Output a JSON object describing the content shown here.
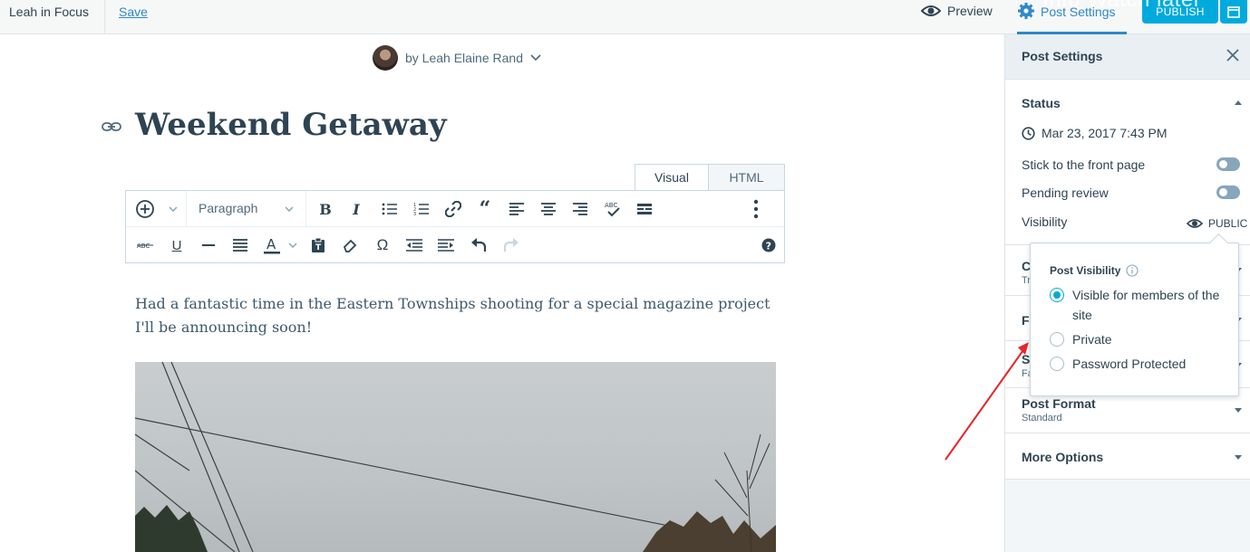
{
  "topbar": {
    "site_name": "Leah in Focus",
    "save_label": "Save",
    "preview_label": "Preview",
    "settings_label": "Post Settings",
    "publish_label": "PUBLISH",
    "overlay_text": "Info   Watch later"
  },
  "editor": {
    "author_label": "by Leah Elaine Rand",
    "title": "Weekend Getaway",
    "tabs": [
      {
        "label": "Visual",
        "active": true
      },
      {
        "label": "HTML",
        "active": false
      }
    ],
    "block_format": "Paragraph",
    "body_text": "Had a fantastic time in the Eastern Townships shooting for a special magazine project I'll be announcing soon!"
  },
  "sidebar": {
    "title": "Post Settings",
    "status": {
      "heading": "Status",
      "date": "Mar 23, 2017 7:43 PM",
      "stick_label": "Stick to the front page",
      "stick_on": false,
      "pending_label": "Pending review",
      "pending_on": false,
      "visibility_label": "Visibility",
      "visibility_value": "PUBLIC"
    },
    "collapsed_sections": [
      {
        "title": "C",
        "subtitle": "Tr"
      },
      {
        "title": "Fe",
        "subtitle": ""
      },
      {
        "title": "Sl",
        "subtitle": "Fa"
      }
    ],
    "post_format": {
      "title": "Post Format",
      "value": "Standard"
    },
    "more_options": "More Options"
  },
  "visibility_popover": {
    "title": "Post Visibility",
    "options": [
      {
        "label": "Visible for members of the site",
        "checked": true
      },
      {
        "label": "Private",
        "checked": false
      },
      {
        "label": "Password Protected",
        "checked": false
      }
    ]
  },
  "colors": {
    "accent": "#00aadc",
    "link": "#2e89c9",
    "annotation_arrow": "#e8252a"
  }
}
